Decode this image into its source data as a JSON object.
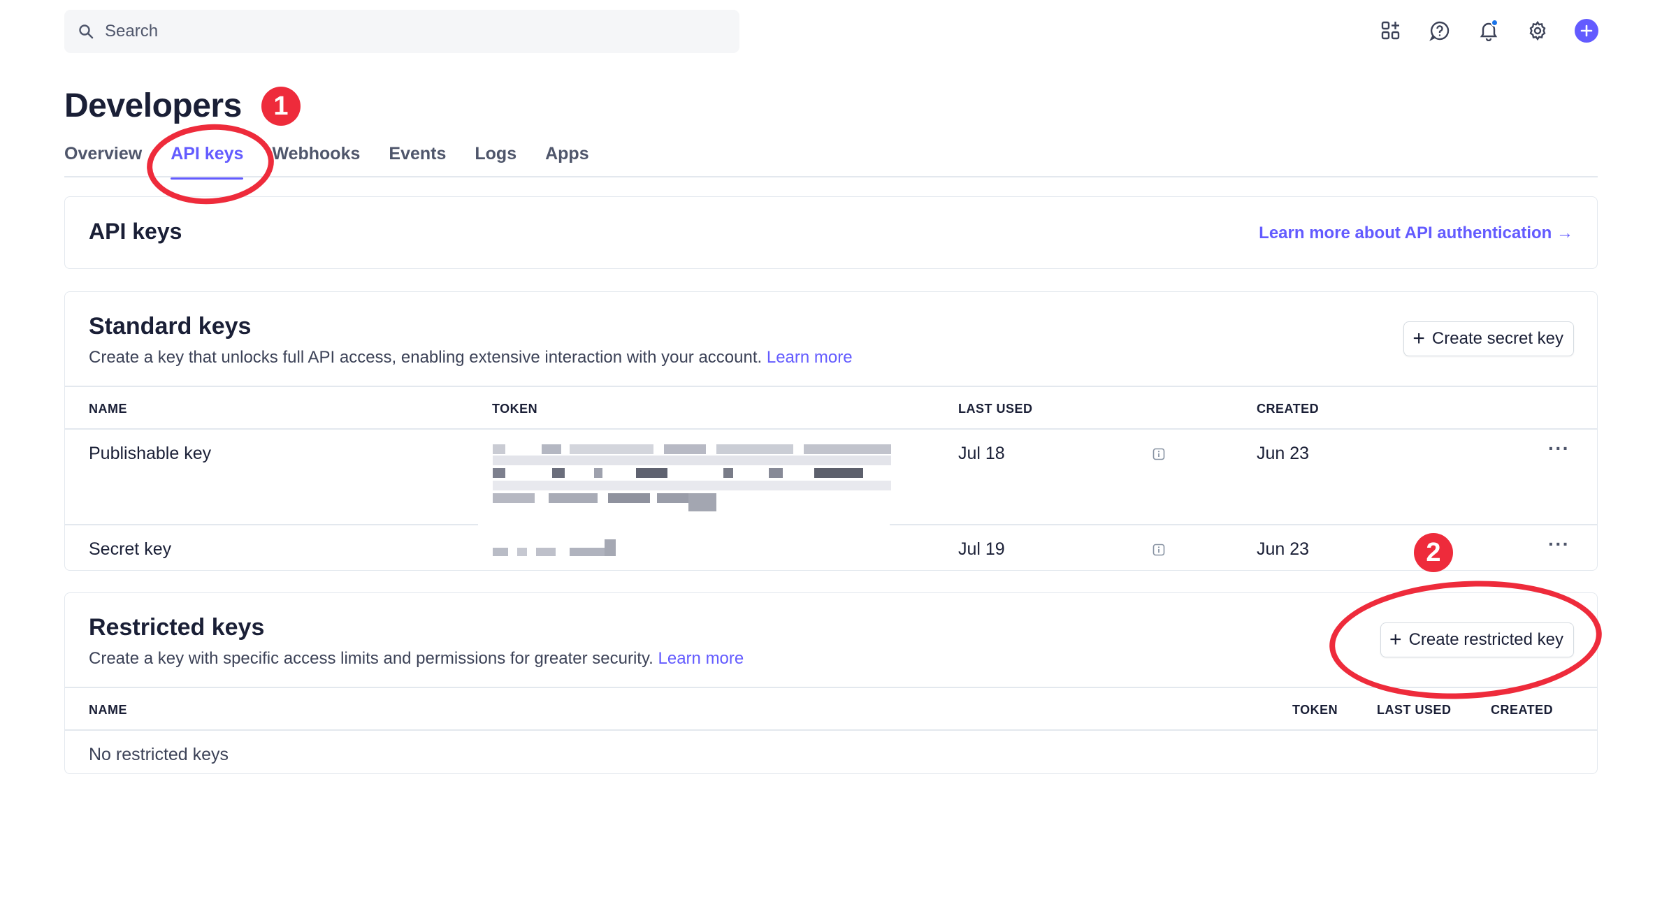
{
  "search": {
    "placeholder": "Search"
  },
  "topbar": {
    "icons": [
      "apps-add-icon",
      "help-icon",
      "notification-bell-icon",
      "settings-gear-icon",
      "create-plus-icon"
    ],
    "accent": "#635bff"
  },
  "header": {
    "title": "Developers",
    "tabs": [
      {
        "label": "Overview"
      },
      {
        "label": "API keys",
        "active": true
      },
      {
        "label": "Webhooks"
      },
      {
        "label": "Events"
      },
      {
        "label": "Logs"
      },
      {
        "label": "Apps"
      }
    ]
  },
  "api_keys_card": {
    "title": "API keys",
    "learn_more": "Learn more about API authentication →"
  },
  "standard_keys": {
    "title": "Standard keys",
    "description": "Create a key that unlocks full API access, enabling extensive interaction with your account.",
    "learn_more": "Learn more",
    "create_button": "Create secret key",
    "columns": {
      "name": "NAME",
      "token": "TOKEN",
      "last_used": "LAST USED",
      "created": "CREATED"
    },
    "rows": [
      {
        "name": "Publishable key",
        "token": "[redacted]",
        "last_used": "Jul 18",
        "created": "Jun 23"
      },
      {
        "name": "Secret key",
        "token": "[redacted]",
        "last_used": "Jul 19",
        "created": "Jun 23"
      }
    ],
    "row_menu": "···"
  },
  "restricted_keys": {
    "title": "Restricted keys",
    "description": "Create a key with specific access limits and permissions for greater security.",
    "learn_more": "Learn more",
    "create_button": "Create restricted key",
    "columns": {
      "name": "NAME",
      "token": "TOKEN",
      "last_used": "LAST USED",
      "created": "CREATED"
    },
    "empty": "No restricted keys"
  },
  "annotations": {
    "badge_1": "1",
    "badge_2": "2",
    "color": "#ee2b3b"
  }
}
